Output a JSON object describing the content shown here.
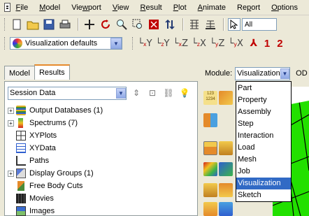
{
  "menubar": {
    "items": [
      {
        "u": "F",
        "rest": "ile"
      },
      {
        "u": "M",
        "rest": "odel"
      },
      {
        "pre": "Vie",
        "u": "w",
        "rest": "port"
      },
      {
        "u": "V",
        "rest": "iew"
      },
      {
        "u": "R",
        "rest": "esult"
      },
      {
        "u": "P",
        "rest": "lot"
      },
      {
        "u": "A",
        "rest": "nimate"
      },
      {
        "pre": "Re",
        "u": "p",
        "rest": "ort"
      },
      {
        "u": "O",
        "rest": "ptions"
      }
    ]
  },
  "toolbar": {
    "selection_filter": "All",
    "view_icons": [
      {
        "base": "Y",
        "sub": "x"
      },
      {
        "base": "Y",
        "sub": "z"
      },
      {
        "base": "Z",
        "sub": "x"
      },
      {
        "base": "X",
        "sub": "z"
      },
      {
        "base": "Z",
        "sub": "y"
      },
      {
        "base": "X",
        "sub": "y"
      }
    ],
    "viewport_numbers": [
      "1",
      "2"
    ]
  },
  "toolbar2": {
    "visualization_defaults": "Visualization defaults"
  },
  "left_panel": {
    "tabs": [
      "Model",
      "Results"
    ],
    "active_tab": "Results",
    "session_select": "Session Data",
    "tree": [
      {
        "label": "Output Databases (1)",
        "expandable": true,
        "icon": "output-database-icon"
      },
      {
        "label": "Spectrums (7)",
        "expandable": true,
        "icon": "spectrum-icon"
      },
      {
        "label": "XYPlots",
        "expandable": false,
        "icon": "xyplot-icon"
      },
      {
        "label": "XYData",
        "expandable": false,
        "icon": "xydata-icon"
      },
      {
        "label": "Paths",
        "expandable": false,
        "icon": "path-icon"
      },
      {
        "label": "Display Groups (1)",
        "expandable": true,
        "icon": "display-group-icon"
      },
      {
        "label": "Free Body Cuts",
        "expandable": false,
        "icon": "free-body-cut-icon"
      },
      {
        "label": "Movies",
        "expandable": false,
        "icon": "movie-icon"
      },
      {
        "label": "Images",
        "expandable": false,
        "icon": "image-icon"
      }
    ]
  },
  "module": {
    "label": "Module:",
    "selected": "Visualization",
    "extra_label": "OD",
    "options": [
      "Part",
      "Property",
      "Assembly",
      "Step",
      "Interaction",
      "Load",
      "Mesh",
      "Job",
      "Visualization",
      "Sketch"
    ]
  },
  "toolbox_text": [
    "123",
    "1234"
  ],
  "colors": {
    "highlight": "#316ac5",
    "tab_accent": "#e68b2c",
    "mesh_green": "#22e000"
  }
}
